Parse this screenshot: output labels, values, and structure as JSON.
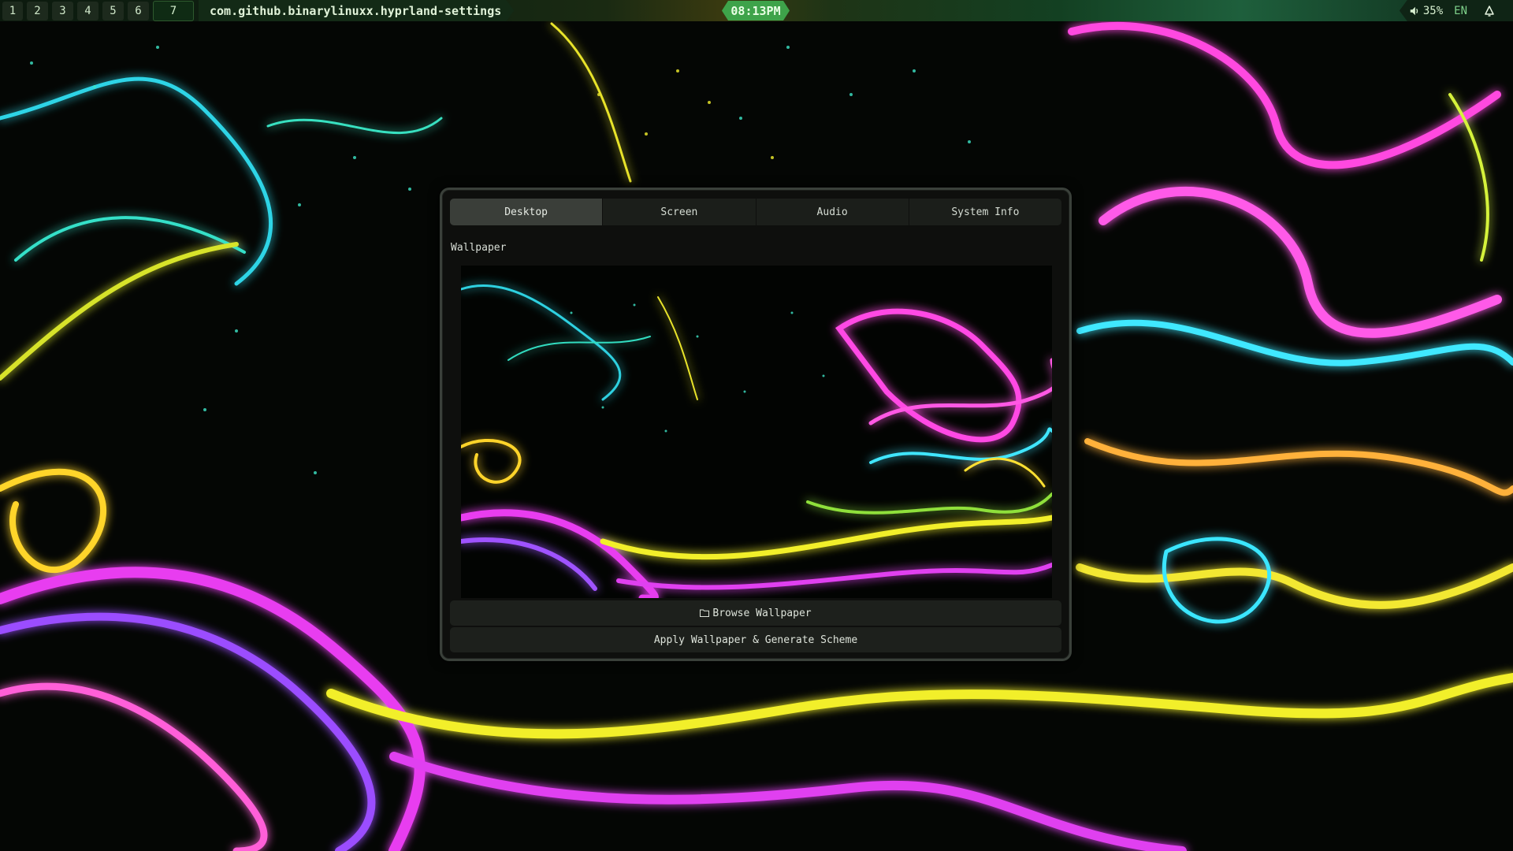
{
  "topbar": {
    "workspaces": [
      "1",
      "2",
      "3",
      "4",
      "5",
      "6",
      "7"
    ],
    "active_workspace": "7",
    "window_title": "com.github.binarylinuxx.hyprland-settings",
    "clock": "08:13PM",
    "volume": "35%",
    "language": "EN",
    "icons": {
      "volume": "speaker-icon",
      "notifications": "bell-icon"
    }
  },
  "settings_window": {
    "tabs": [
      {
        "label": "Desktop",
        "active": true
      },
      {
        "label": "Screen",
        "active": false
      },
      {
        "label": "Audio",
        "active": false
      },
      {
        "label": "System Info",
        "active": false
      }
    ],
    "section_label": "Wallpaper",
    "browse_button": "Browse Wallpaper",
    "apply_button": "Apply Wallpaper & Generate Scheme"
  },
  "colors": {
    "accent_green": "#3ea34a",
    "window_bg": "#0e0f0d",
    "tab_active": "#3a3e39"
  }
}
